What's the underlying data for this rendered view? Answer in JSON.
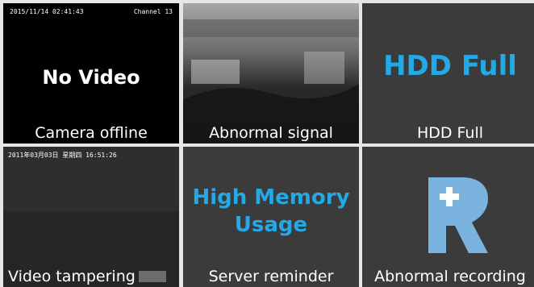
{
  "tiles": [
    {
      "caption": "Camera offline",
      "osd_datetime": "2015/11/14 02:41:43",
      "osd_channel": "Channel 13",
      "overlay": "No Video"
    },
    {
      "caption": "Abnormal signal"
    },
    {
      "caption": "HDD Full",
      "overlay": "HDD Full"
    },
    {
      "caption": "Video tampering",
      "osd_datetime": "2011年03月03日 星期四 16:51:26"
    },
    {
      "caption": "Server reminder",
      "overlay": [
        "High Memory",
        "Usage"
      ]
    },
    {
      "caption": "Abnormal recording",
      "icon": "recording-alert-icon"
    }
  ],
  "colors": {
    "accent": "#23a9e6",
    "icon": "#7ab3dd"
  }
}
